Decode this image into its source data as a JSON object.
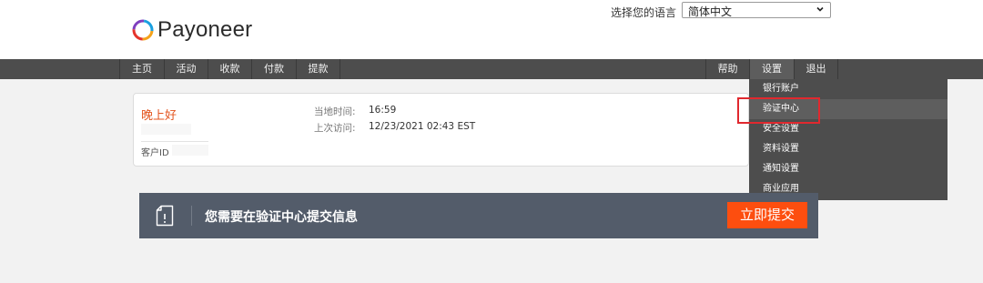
{
  "brand": {
    "name": "Payoneer",
    "logo_icon": "payoneer-ring-logo"
  },
  "language": {
    "label": "选择您的语言",
    "selected": "简体中文"
  },
  "nav": {
    "left": [
      "主页",
      "活动",
      "收款",
      "付款",
      "提款"
    ],
    "right": [
      "帮助",
      "设置",
      "退出"
    ],
    "active": "设置"
  },
  "settings_menu": {
    "items": [
      "银行账户",
      "验证中心",
      "安全设置",
      "资料设置",
      "通知设置",
      "商业应用"
    ],
    "highlighted": "验证中心"
  },
  "account": {
    "greeting": "晚上好",
    "customer_id_label": "客户ID",
    "local_time_label": "当地时间:",
    "local_time_value": "16:59",
    "last_visit_label": "上次访问:",
    "last_visit_value": "12/23/2021 02:43 EST"
  },
  "banner": {
    "icon": "document-alert-icon",
    "message": "您需要在验证中心提交信息",
    "button_label": "立即提交"
  },
  "colors": {
    "accent_orange": "#fd4e0f",
    "greeting_orange": "#e3541e",
    "highlight_red": "#e0282e",
    "nav_bg": "#4d4d4d",
    "banner_bg": "#535c6a"
  }
}
